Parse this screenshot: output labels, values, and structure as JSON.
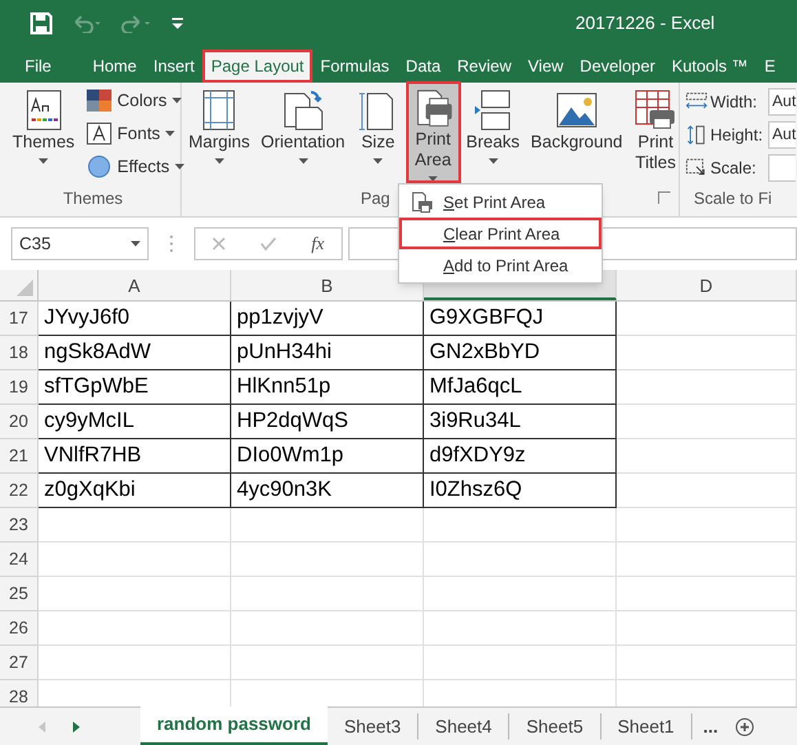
{
  "quick_access": [
    {
      "kind": "save",
      "disabled": false
    },
    {
      "kind": "undo",
      "disabled": true
    },
    {
      "kind": "redo",
      "disabled": true
    },
    {
      "kind": "customize",
      "disabled": false
    }
  ],
  "window": {
    "title": "20171226 - Excel"
  },
  "tabs": [
    {
      "label": "File",
      "selected": false,
      "highlighted": false
    },
    {
      "label": "Home",
      "selected": false,
      "highlighted": false
    },
    {
      "label": "Insert",
      "selected": false,
      "highlighted": false
    },
    {
      "label": "Page Layout",
      "selected": true,
      "highlighted": true
    },
    {
      "label": "Formulas",
      "selected": false,
      "highlighted": false
    },
    {
      "label": "Data",
      "selected": false,
      "highlighted": false
    },
    {
      "label": "Review",
      "selected": false,
      "highlighted": false
    },
    {
      "label": "View",
      "selected": false,
      "highlighted": false
    },
    {
      "label": "Developer",
      "selected": false,
      "highlighted": false
    },
    {
      "label": "Kutools ™",
      "selected": false,
      "highlighted": false
    },
    {
      "label": "E",
      "selected": false,
      "highlighted": false
    }
  ],
  "ribbon": {
    "groups": [
      {
        "label": "Themes",
        "controls": [
          {
            "kind": "large",
            "lines": [
              "Themes"
            ],
            "dropdown": true,
            "pressed": false,
            "highlighted": false
          },
          {
            "kind": "stack",
            "items": [
              {
                "label": "Colors"
              },
              {
                "label": "Fonts"
              },
              {
                "label": "Effects"
              }
            ]
          }
        ]
      },
      {
        "label": "Pag",
        "launcher": true,
        "controls": [
          {
            "kind": "large",
            "lines": [
              "Margins"
            ],
            "dropdown": true,
            "pressed": false,
            "highlighted": false
          },
          {
            "kind": "large",
            "lines": [
              "Orientation"
            ],
            "dropdown": true,
            "pressed": false,
            "highlighted": false
          },
          {
            "kind": "large",
            "lines": [
              "Size"
            ],
            "dropdown": true,
            "pressed": false,
            "highlighted": false
          },
          {
            "kind": "large",
            "lines": [
              "Print",
              "Area"
            ],
            "dropdown": true,
            "pressed": true,
            "highlighted": true
          },
          {
            "kind": "large",
            "lines": [
              "Breaks"
            ],
            "dropdown": true,
            "pressed": false,
            "highlighted": false
          },
          {
            "kind": "large",
            "lines": [
              "Background"
            ],
            "dropdown": false,
            "pressed": false,
            "highlighted": false
          },
          {
            "kind": "large",
            "lines": [
              "Print",
              "Titles"
            ],
            "dropdown": false,
            "pressed": false,
            "highlighted": false
          }
        ]
      },
      {
        "label": "Scale to Fi",
        "controls": [
          {
            "kind": "fields",
            "items": [
              {
                "label": "Width:",
                "value": "Aut"
              },
              {
                "label": "Height:",
                "value": "Aut"
              },
              {
                "label": "Scale:"
              }
            ]
          }
        ]
      }
    ]
  },
  "menu": {
    "items": [
      {
        "label": "Set Print Area",
        "icon": true,
        "highlighted": false
      },
      {
        "label": "Clear Print Area",
        "icon": false,
        "highlighted": true
      },
      {
        "label": "Add to Print Area",
        "icon": false,
        "highlighted": false
      }
    ]
  },
  "formula_bar": {
    "name_box": "C35",
    "function_label": "fx"
  },
  "grid": {
    "columns": [
      {
        "label": "A",
        "selected": false
      },
      {
        "label": "B",
        "selected": false
      },
      {
        "selected": true
      },
      {
        "label": "D",
        "selected": false
      }
    ],
    "rows": [
      {
        "header": "17",
        "cells": [
          "JYvyJ6f0",
          "pp1zvjyV",
          "G9XGBFQJ"
        ]
      },
      {
        "header": "18",
        "cells": [
          "ngSk8AdW",
          "pUnH34hi",
          "GN2xBbYD"
        ]
      },
      {
        "header": "19",
        "cells": [
          "sfTGpWbE",
          "HlKnn51p",
          "MfJa6qcL"
        ]
      },
      {
        "header": "20",
        "cells": [
          "cy9yMcIL",
          "HP2dqWqS",
          "3i9Ru34L"
        ]
      },
      {
        "header": "21",
        "cells": [
          "VNlfR7HB",
          "DIo0Wm1p",
          "d9fXDY9z"
        ]
      },
      {
        "header": "22",
        "cells": [
          "z0gXqKbi",
          "4yc90n3K",
          "I0Zhsz6Q"
        ]
      },
      {
        "header": "23"
      },
      {
        "header": "24"
      },
      {
        "header": "25"
      },
      {
        "header": "26"
      },
      {
        "header": "27"
      },
      {
        "header": "28"
      }
    ]
  },
  "sheets": {
    "prev_disabled": true,
    "tabs": [
      {
        "label": "random password",
        "selected": true
      },
      {
        "label": "Sheet3",
        "selected": false
      },
      {
        "label": "Sheet4",
        "selected": false
      },
      {
        "label": "Sheet5",
        "selected": false
      },
      {
        "label": "Sheet1",
        "selected": false
      }
    ],
    "more": "..."
  }
}
